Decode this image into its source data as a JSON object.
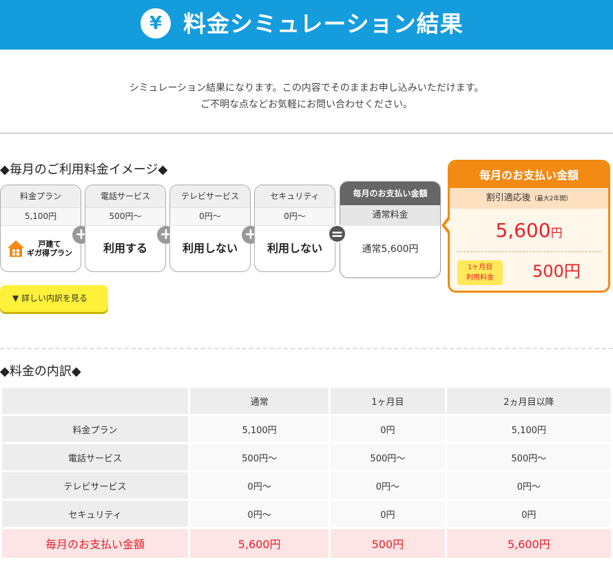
{
  "header": {
    "icon": "yen-icon",
    "icon_glyph": "¥",
    "title": "料金シミュレーション結果"
  },
  "intro": {
    "line1": "シミュレーション結果になります。この内容でそのままお申し込みいただけます。",
    "line2": "ご不明な点などお気軽にお問い合わせください。"
  },
  "monthly_image": {
    "heading": "◆毎月のご利用料金イメージ◆",
    "cards": [
      {
        "title": "料金プラン",
        "price": "5,100円",
        "value_line1": "戸建て",
        "value_line2": "ギガ得プラン",
        "icon": "house-icon"
      },
      {
        "title": "電話サービス",
        "price": "500円〜",
        "value": "利用する"
      },
      {
        "title": "テレビサービス",
        "price": "0円〜",
        "value": "利用しない"
      },
      {
        "title": "セキュリティ",
        "price": "0円〜",
        "value": "利用しない"
      }
    ],
    "plus_symbol": "+",
    "equals_symbol": "=",
    "total_card": {
      "title": "毎月のお支払い金額",
      "subtitle": "通常料金",
      "value": "通常5,600円"
    },
    "payment_box": {
      "title": "毎月のお支払い金額",
      "discount_label": "割引適応後",
      "discount_note": "（最大2年間）",
      "amount_number": "5,600",
      "amount_unit": "円",
      "first_month_badge_line1": "1ヶ月目",
      "first_month_badge_line2": "利用料金",
      "first_month_amount": "500円"
    },
    "detail_button": "▼ 詳しい内訳を見る"
  },
  "breakdown": {
    "heading": "◆料金の内訳◆",
    "columns": [
      "",
      "通常",
      "1ヶ月目",
      "2ヵ月目以降"
    ],
    "rows": [
      {
        "label": "料金プラン",
        "values": [
          "5,100円",
          "0円",
          "5,100円"
        ]
      },
      {
        "label": "電話サービス",
        "values": [
          "500円〜",
          "500円〜",
          "500円〜"
        ]
      },
      {
        "label": "テレビサービス",
        "values": [
          "0円〜",
          "0円〜",
          "0円〜"
        ]
      },
      {
        "label": "セキュリティ",
        "values": [
          "0円〜",
          "0円",
          "0円"
        ]
      }
    ],
    "total_row": {
      "label": "毎月のお支払い金額",
      "values": [
        "5,600円",
        "500円",
        "5,600円"
      ]
    }
  },
  "colors": {
    "header_blue": "#149cdd",
    "accent_orange": "#f28a14",
    "price_red": "#e6202a",
    "button_yellow": "#fff13a"
  }
}
